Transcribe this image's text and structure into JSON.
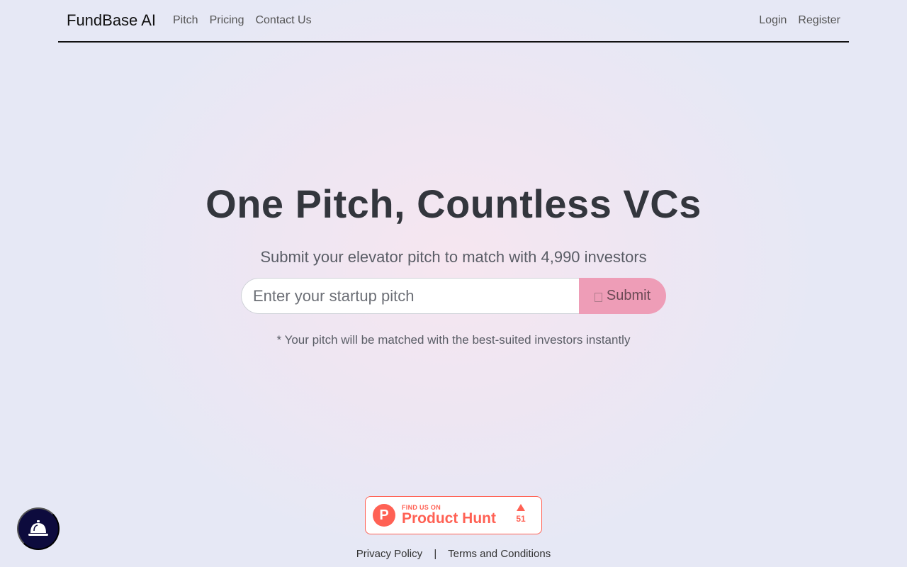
{
  "nav": {
    "brand": "FundBase AI",
    "links": [
      "Pitch",
      "Pricing",
      "Contact Us"
    ],
    "login": "Login",
    "register": "Register"
  },
  "hero": {
    "title": "One Pitch, Countless VCs",
    "subtitle": "Submit your elevator pitch to match with 4,990 investors",
    "input_placeholder": "Enter your startup pitch",
    "input_value": "",
    "submit_label": "Submit",
    "note": "* Your pitch will be matched with the best-suited investors instantly"
  },
  "product_hunt": {
    "logo_letter": "P",
    "find_us": "FIND US ON",
    "name": "Product Hunt",
    "votes": "51"
  },
  "footer": {
    "privacy": "Privacy Policy",
    "separator": "|",
    "terms": "Terms and Conditions"
  },
  "icons": {
    "bell": "concierge-bell-icon",
    "submit": "send-icon",
    "upvote": "upvote-arrow-icon"
  },
  "colors": {
    "submit_bg": "#ee9db7",
    "product_hunt": "#ff6154",
    "bell_bg": "#0d0b3d"
  }
}
